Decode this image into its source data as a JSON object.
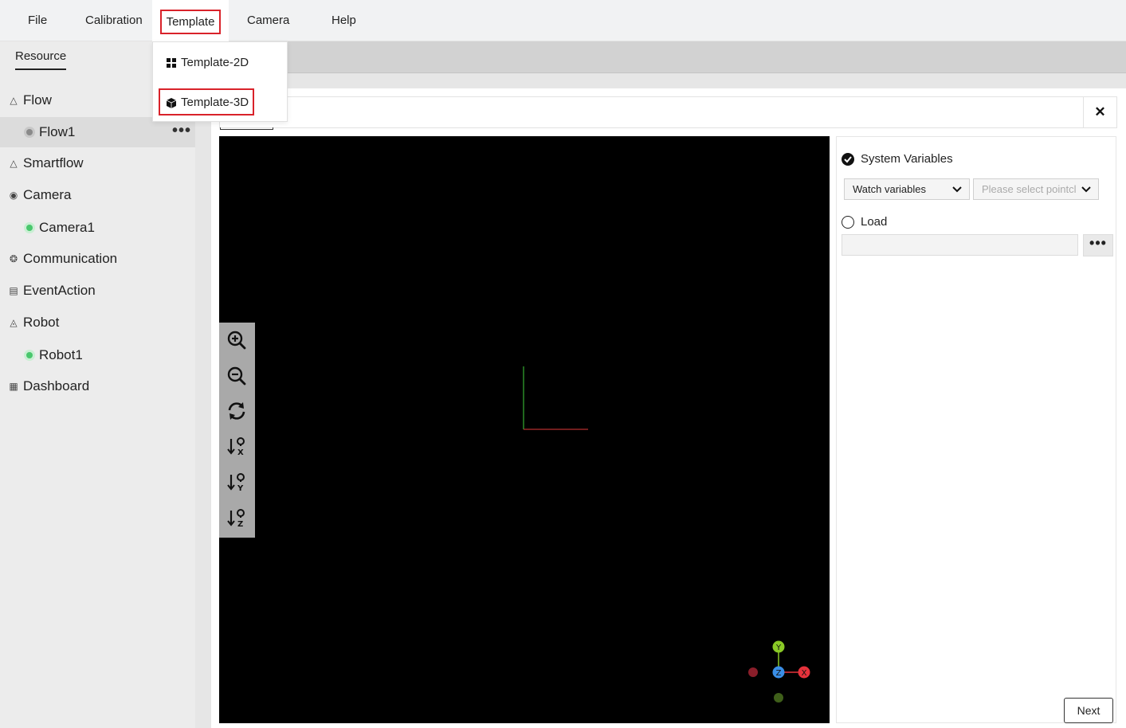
{
  "menubar": {
    "items": [
      {
        "label": "File"
      },
      {
        "label": "Calibration"
      },
      {
        "label": "Template"
      },
      {
        "label": "Camera"
      },
      {
        "label": "Help"
      }
    ]
  },
  "template_menu": {
    "items": [
      {
        "label": "Template-2D",
        "icon": "grid-icon"
      },
      {
        "label": "Template-3D",
        "icon": "cube-icon"
      }
    ]
  },
  "sidebar": {
    "tab": "Resource",
    "tree": [
      {
        "label": "Flow",
        "icon": "flow-icon"
      },
      {
        "label": "Flow1",
        "child": true,
        "status": "gray"
      },
      {
        "label": "Smartflow",
        "icon": "smartflow-icon"
      },
      {
        "label": "Camera",
        "icon": "camera-icon"
      },
      {
        "label": "Camera1",
        "child": true,
        "status": "green"
      },
      {
        "label": "Communication",
        "icon": "communication-icon"
      },
      {
        "label": "EventAction",
        "icon": "eventaction-icon"
      },
      {
        "label": "Robot",
        "icon": "robot-icon"
      },
      {
        "label": "Robot1",
        "child": true,
        "status": "green"
      },
      {
        "label": "Dashboard",
        "icon": "dashboard-icon"
      }
    ],
    "more_label": "•••"
  },
  "panel": {
    "close_label": "✕"
  },
  "viewer": {
    "toolbar": [
      "zoom-in-icon",
      "zoom-out-icon",
      "reset-view-icon",
      "view-x-icon",
      "view-y-icon",
      "view-z-icon"
    ],
    "axes": {
      "x": "X",
      "y": "Y",
      "z": "Z"
    },
    "colors": {
      "x": "#e5323b",
      "y": "#8ac926",
      "z": "#3a8ee6",
      "neg_x": "#8a1e2a",
      "neg_y": "#3f5f1a"
    }
  },
  "settings": {
    "system_variables_label": "System Variables",
    "watch_select": "Watch variables",
    "pointcloud_placeholder": "Please select pointcl",
    "load_label": "Load",
    "path_value": "",
    "browse_label": "•••",
    "next_label": "Next"
  },
  "colors": {
    "highlight": "#d9222a",
    "status_green": "#49c76d"
  }
}
